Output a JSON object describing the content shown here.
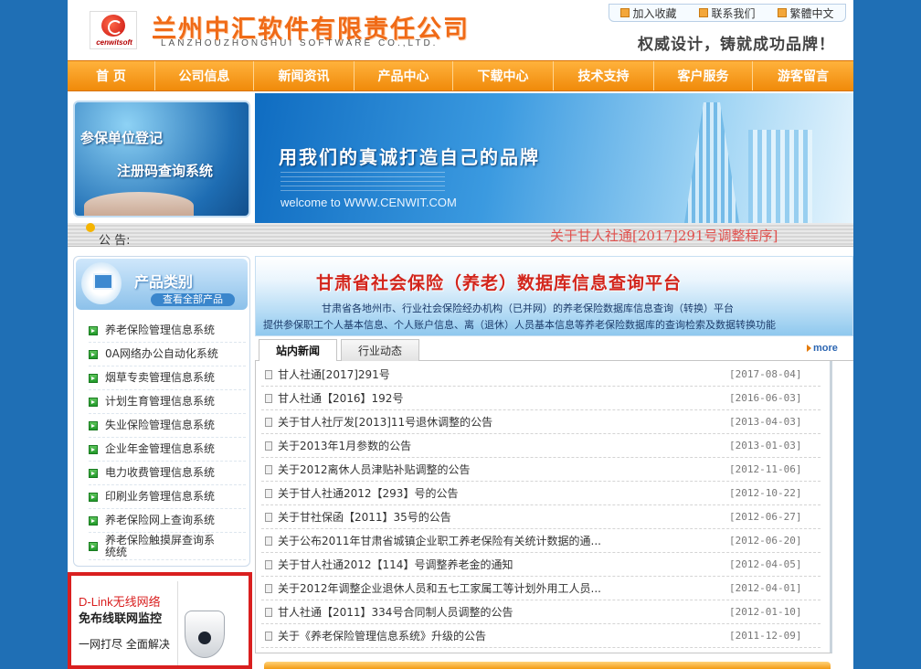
{
  "header": {
    "logo_sub": "cenwitsoft",
    "company_cn": "兰州中汇软件有限责任公司",
    "company_en": "LANZHOUZHONGHUI SOFTWARE  CO.,LTD.",
    "slogan": "权威设计，铸就成功品牌！",
    "toplinks": [
      "加入收藏",
      "联系我们",
      "繁體中文"
    ]
  },
  "nav": [
    "首 页",
    "公司信息",
    "新闻资讯",
    "产品中心",
    "下载中心",
    "技术支持",
    "客户服务",
    "游客留言"
  ],
  "promo": {
    "line1": "参保单位登记",
    "line2": "注册码查询系统"
  },
  "hero": {
    "slogan": "用我们的真诚打造自己的品牌",
    "welcome": "welcome to WWW.CENWIT.COM"
  },
  "notice": {
    "label": "公 告:",
    "text": "关于甘人社通[2017]291号调整程序]"
  },
  "categories": {
    "title": "产品类别",
    "view_all": "查看全部产品",
    "items": [
      "养老保险管理信息系统",
      "0A网络办公自动化系统",
      "烟草专卖管理信息系统",
      "计划生育管理信息系统",
      "失业保险管理信息系统",
      "企业年金管理信息系统",
      "电力收费管理信息系统",
      "印刷业务管理信息系统",
      "养老保险网上查询系统",
      "养老保险触摸屏查询系统统"
    ]
  },
  "ad": {
    "line1": "D-Link无线网络",
    "line2": "免布线联网监控",
    "line3": "一网打尽 全面解决"
  },
  "platform": {
    "title": "甘肃省社会保险（养老）数据库信息查询平台",
    "desc1": "甘肃省各地州市、行业社会保险经办机构（已并网）的养老保险数据库信息查询（转换）平台",
    "desc2": "提供参保职工个人基本信息、个人账户信息、离（退休）人员基本信息等养老保险数据库的查询检索及数据转换功能"
  },
  "tabs": {
    "items": [
      "站内新闻",
      "行业动态"
    ],
    "more": "more"
  },
  "news": [
    {
      "title": "甘人社通[2017]291号",
      "date": "[2017-08-04]"
    },
    {
      "title": "甘人社通【2016】192号",
      "date": "[2016-06-03]"
    },
    {
      "title": "关于甘人社厅发[2013]11号退休调整的公告",
      "date": "[2013-04-03]"
    },
    {
      "title": "关于2013年1月参数的公告",
      "date": "[2013-01-03]"
    },
    {
      "title": "关于2012离休人员津贴补贴调整的公告",
      "date": "[2012-11-06]"
    },
    {
      "title": "关于甘人社通2012【293】号的公告",
      "date": "[2012-10-22]"
    },
    {
      "title": "关于甘社保函【2011】35号的公告",
      "date": "[2012-06-27]"
    },
    {
      "title": "关于公布2011年甘肃省城镇企业职工养老保险有关统计数据的通...",
      "date": "[2012-06-20]"
    },
    {
      "title": "关于甘人社通2012【114】号调整养老金的通知",
      "date": "[2012-04-05]"
    },
    {
      "title": "关于2012年调整企业退休人员和五七工家属工等计划外用工人员...",
      "date": "[2012-04-01]"
    },
    {
      "title": "甘人社通【2011】334号合同制人员调整的公告",
      "date": "[2012-01-10]"
    },
    {
      "title": "关于《养老保险管理信息系统》升级的公告",
      "date": "[2011-12-09]"
    }
  ]
}
